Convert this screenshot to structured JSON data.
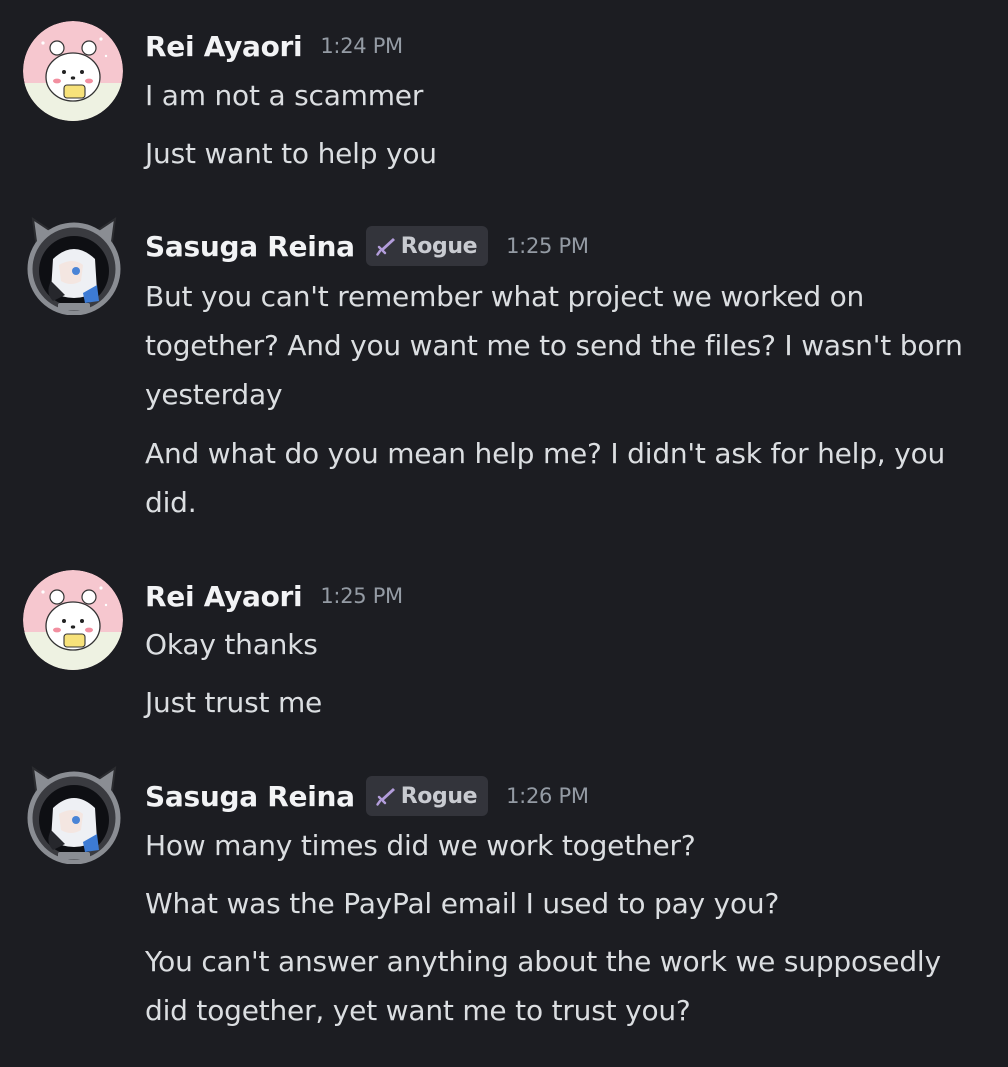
{
  "messages": [
    {
      "author": "Rei Ayaori",
      "avatar": "bear-avatar",
      "timestamp": "1:24 PM",
      "lines": [
        "I am not a scammer",
        "Just want to help you"
      ]
    },
    {
      "author": "Sasuga Reina",
      "avatar": "anime-girl-avatar",
      "role": {
        "icon": "sword-icon",
        "label": "Rogue"
      },
      "timestamp": "1:25 PM",
      "lines": [
        "But you can't remember what project we worked on together? And you want me to send the files? I wasn't born yesterday",
        "And what do you mean help me? I didn't ask for help, you did."
      ]
    },
    {
      "author": "Rei Ayaori",
      "avatar": "bear-avatar",
      "timestamp": "1:25 PM",
      "lines": [
        "Okay thanks",
        "Just trust me"
      ]
    },
    {
      "author": "Sasuga Reina",
      "avatar": "anime-girl-avatar",
      "role": {
        "icon": "sword-icon",
        "label": "Rogue"
      },
      "timestamp": "1:26 PM",
      "lines": [
        "How many times did we work together?",
        "What was the PayPal email I used to pay you?",
        "You can't answer anything about the work we supposedly did together, yet want me to trust you?"
      ]
    }
  ],
  "colors": {
    "background": "#1c1d22",
    "username": "#f2f3f5",
    "message_text": "#dbdee1",
    "timestamp": "#949ba4",
    "role_tag_bg": "#33343b",
    "role_icon": "#b39ddb"
  }
}
